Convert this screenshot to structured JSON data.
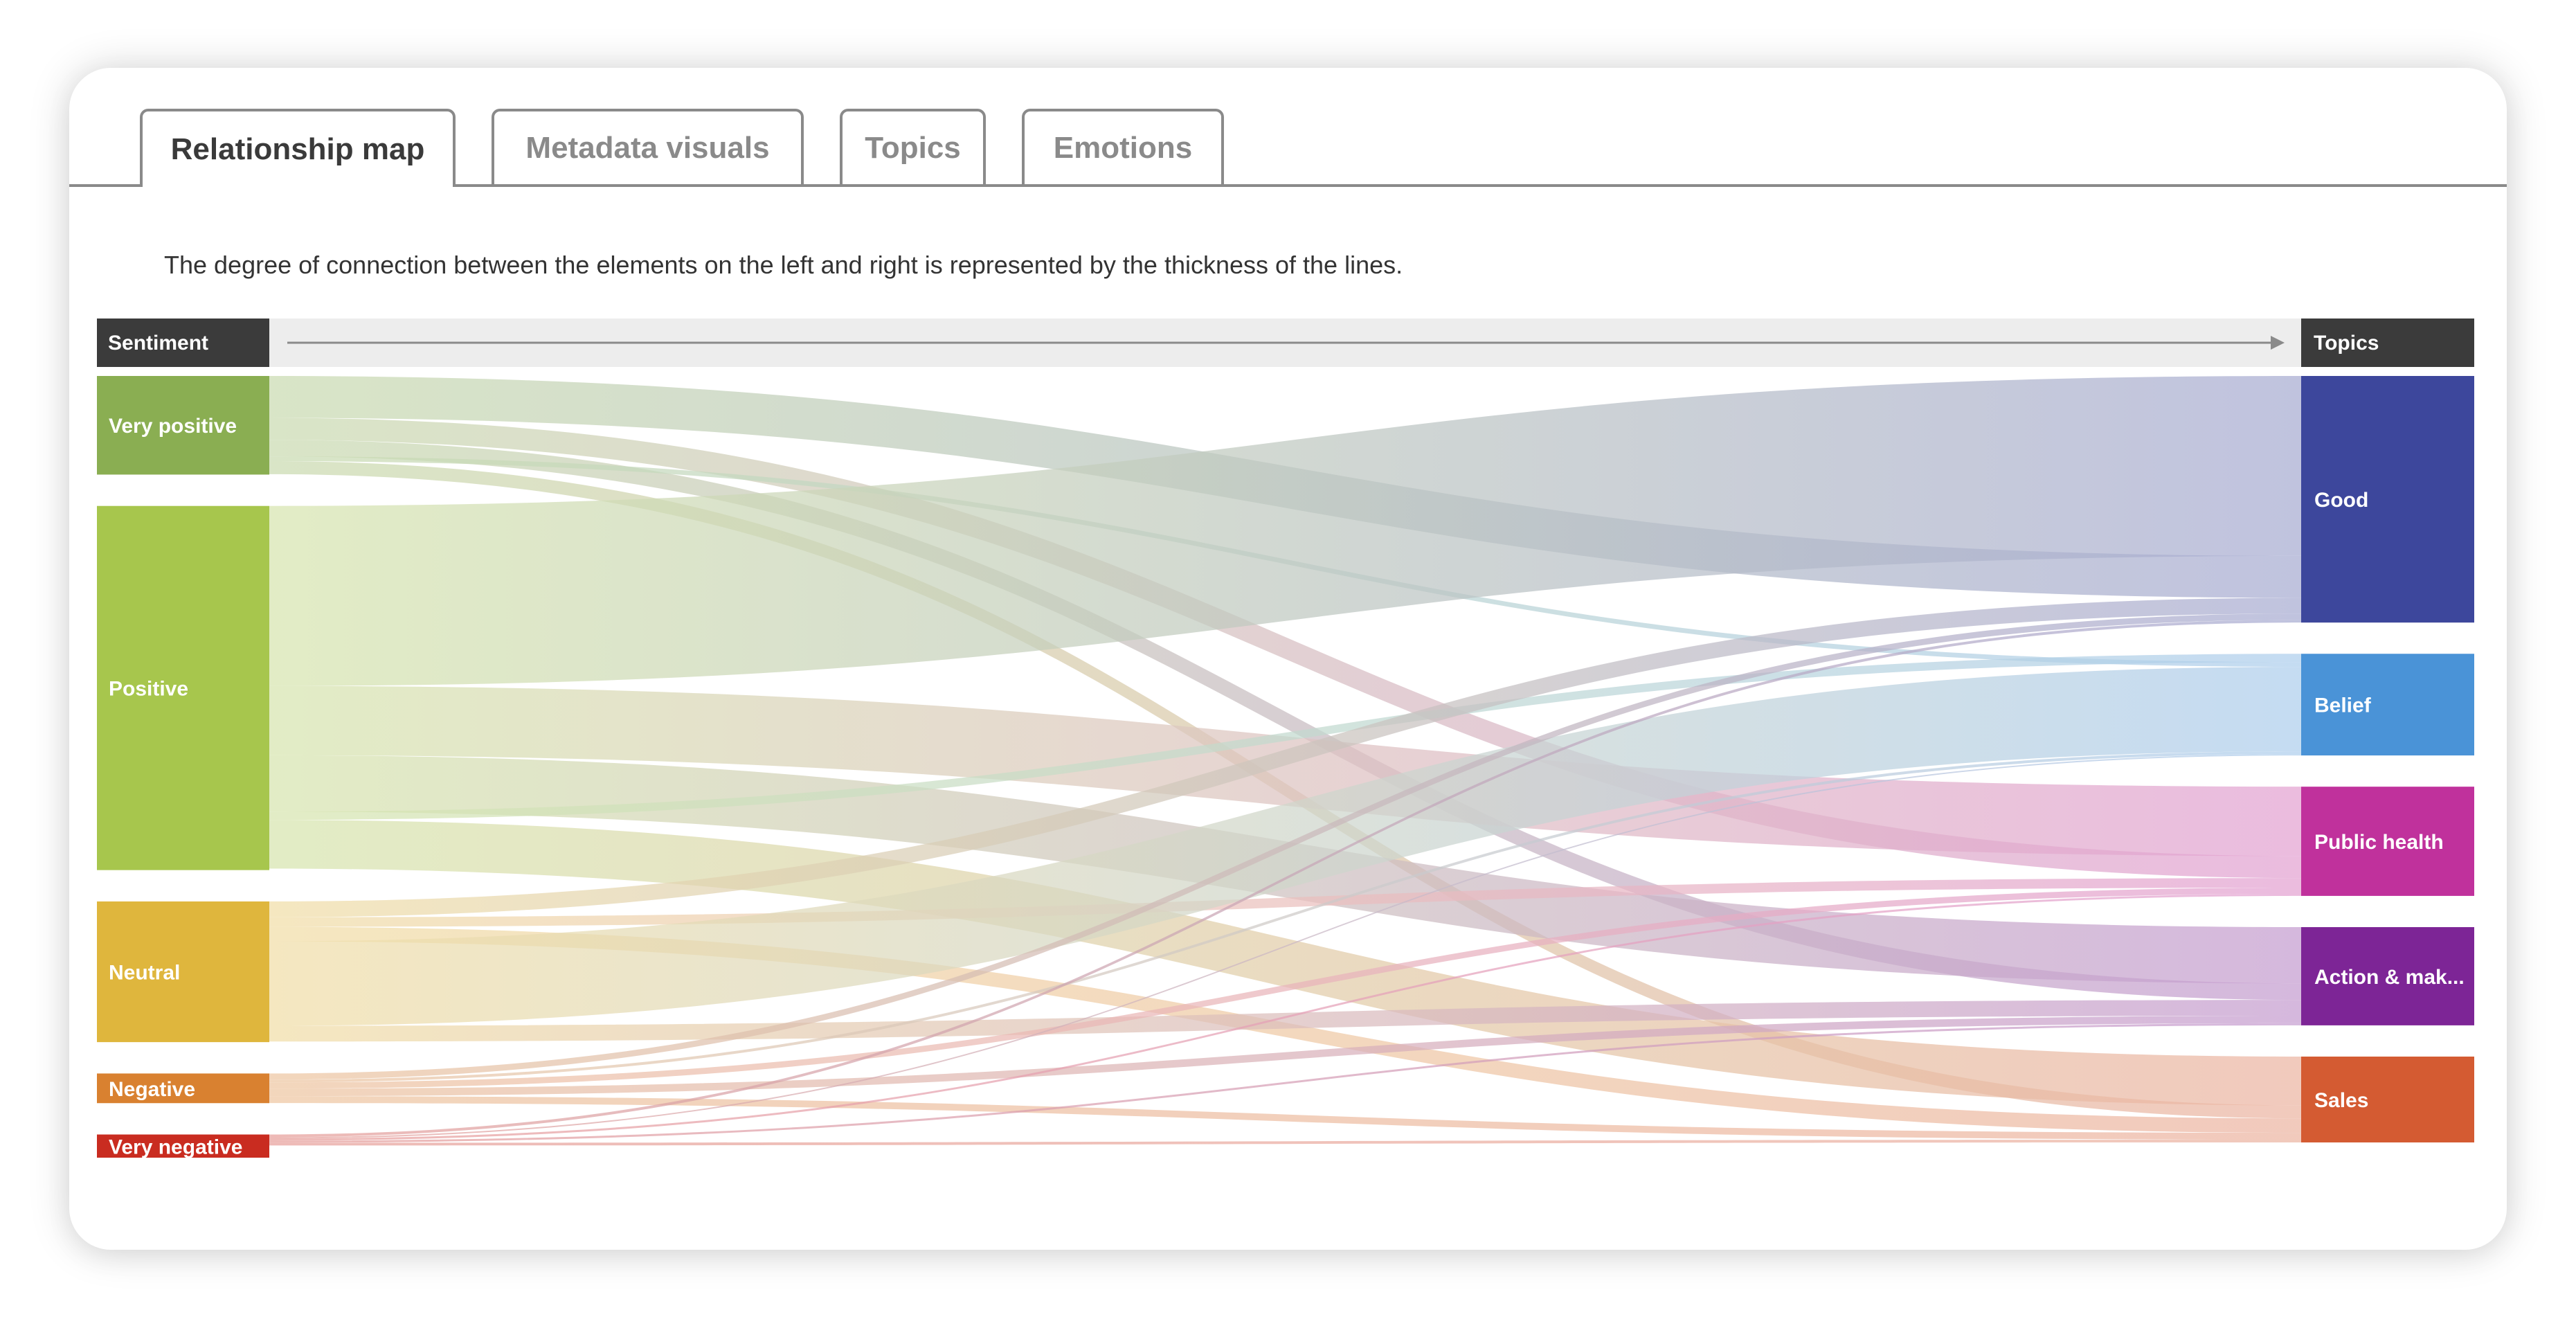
{
  "tabs": [
    {
      "label": "Relationship map",
      "active": true
    },
    {
      "label": "Metadata visuals",
      "active": false
    },
    {
      "label": "Topics",
      "active": false
    },
    {
      "label": "Emotions",
      "active": false
    }
  ],
  "description": "The degree of connection between the elements on the left and right is represented by the thickness of the lines.",
  "colors": {
    "header_bg": "#3b3b3b",
    "header_bar": "#ededed",
    "arrow": "#8a8a8a",
    "tab_border": "#8a8a8a",
    "tab_active_text": "#3a3a3a",
    "tab_inactive_text": "#8a8a8a"
  },
  "chart_data": {
    "type": "sankey",
    "title": "Relationship map",
    "left_header": "Sentiment",
    "right_header": "Topics",
    "sources": [
      {
        "name": "Very positive",
        "color": "#8aae52"
      },
      {
        "name": "Positive",
        "color": "#a7c64d"
      },
      {
        "name": "Neutral",
        "color": "#dfb63d"
      },
      {
        "name": "Negative",
        "color": "#d98130"
      },
      {
        "name": "Very negative",
        "color": "#c92c20"
      }
    ],
    "targets": [
      {
        "name": "Good",
        "color": "#3d479c"
      },
      {
        "name": "Belief",
        "color": "#4a93d7"
      },
      {
        "name": "Public health",
        "color": "#c0319c"
      },
      {
        "name": "Action & mak...",
        "color": "#7d2596"
      },
      {
        "name": "Sales",
        "color": "#d45b32"
      }
    ],
    "links": [
      {
        "source": "Very positive",
        "target": "Good",
        "value": 61
      },
      {
        "source": "Very positive",
        "target": "Public health",
        "value": 32
      },
      {
        "source": "Very positive",
        "target": "Action & mak...",
        "value": 24
      },
      {
        "source": "Very positive",
        "target": "Belief",
        "value": 7
      },
      {
        "source": "Very positive",
        "target": "Sales",
        "value": 19
      },
      {
        "source": "Positive",
        "target": "Good",
        "value": 262
      },
      {
        "source": "Positive",
        "target": "Public health",
        "value": 101
      },
      {
        "source": "Positive",
        "target": "Action & mak...",
        "value": 82
      },
      {
        "source": "Positive",
        "target": "Belief",
        "value": 12
      },
      {
        "source": "Positive",
        "target": "Sales",
        "value": 71
      },
      {
        "source": "Neutral",
        "target": "Good",
        "value": 23
      },
      {
        "source": "Neutral",
        "target": "Public health",
        "value": 14
      },
      {
        "source": "Neutral",
        "target": "Sales",
        "value": 21
      },
      {
        "source": "Neutral",
        "target": "Belief",
        "value": 123
      },
      {
        "source": "Neutral",
        "target": "Action & mak...",
        "value": 23
      },
      {
        "source": "Negative",
        "target": "Good",
        "value": 9
      },
      {
        "source": "Negative",
        "target": "Belief",
        "value": 4
      },
      {
        "source": "Negative",
        "target": "Public health",
        "value": 9
      },
      {
        "source": "Negative",
        "target": "Action & mak...",
        "value": 11
      },
      {
        "source": "Negative",
        "target": "Sales",
        "value": 10
      },
      {
        "source": "Very negative",
        "target": "Good",
        "value": 4
      },
      {
        "source": "Very negative",
        "target": "Belief",
        "value": 2
      },
      {
        "source": "Very negative",
        "target": "Public health",
        "value": 3
      },
      {
        "source": "Very negative",
        "target": "Action & mak...",
        "value": 3
      },
      {
        "source": "Very negative",
        "target": "Sales",
        "value": 4
      }
    ]
  }
}
